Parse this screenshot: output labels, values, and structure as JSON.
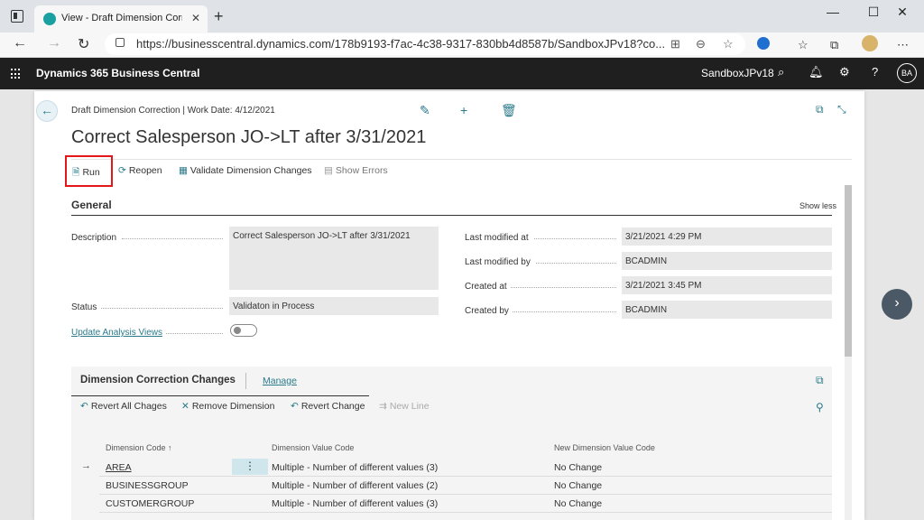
{
  "browser": {
    "tab_title": "View - Draft Dimension Correction",
    "url": "https://businesscentral.dynamics.com/178b9193-f7ac-4c38-9317-830bb4d8587b/SandboxJPv18?co..."
  },
  "app": {
    "title": "Dynamics 365 Business Central",
    "company": "SandboxJPv18",
    "user_initials": "BA"
  },
  "page": {
    "breadcrumb": "Draft Dimension Correction | Work Date: 4/12/2021",
    "title": "Correct Salesperson JO->LT after 3/31/2021"
  },
  "actions": {
    "run": "Run",
    "reopen": "Reopen",
    "validate": "Validate Dimension Changes",
    "show_errors": "Show Errors"
  },
  "general": {
    "title": "General",
    "show_less": "Show less",
    "description_label": "Description",
    "description_value": "Correct Salesperson JO->LT after 3/31/2021",
    "status_label": "Status",
    "status_value": "Validaton in Process",
    "update_label": "Update Analysis Views",
    "last_modified_at_label": "Last modified at",
    "last_modified_at_value": "3/21/2021 4:29 PM",
    "last_modified_by_label": "Last modified by",
    "last_modified_by_value": "BCADMIN",
    "created_at_label": "Created at",
    "created_at_value": "3/21/2021 3:45 PM",
    "created_by_label": "Created by",
    "created_by_value": "BCADMIN"
  },
  "subpage": {
    "title": "Dimension Correction Changes",
    "manage": "Manage",
    "actions": {
      "revert_all": "Revert All Chages",
      "remove_dim": "Remove Dimension",
      "revert_change": "Revert Change",
      "new_line": "New Line"
    },
    "columns": {
      "dim_code": "Dimension Code",
      "dim_value_code": "Dimension Value Code",
      "new_dim_value_code": "New Dimension Value Code"
    },
    "rows": [
      {
        "dim_code": "AREA",
        "dim_value": "Multiple - Number of different values (3)",
        "new_value": "No Change"
      },
      {
        "dim_code": "BUSINESSGROUP",
        "dim_value": "Multiple - Number of different values (2)",
        "new_value": "No Change"
      },
      {
        "dim_code": "CUSTOMERGROUP",
        "dim_value": "Multiple - Number of different values (3)",
        "new_value": "No Change"
      }
    ]
  }
}
